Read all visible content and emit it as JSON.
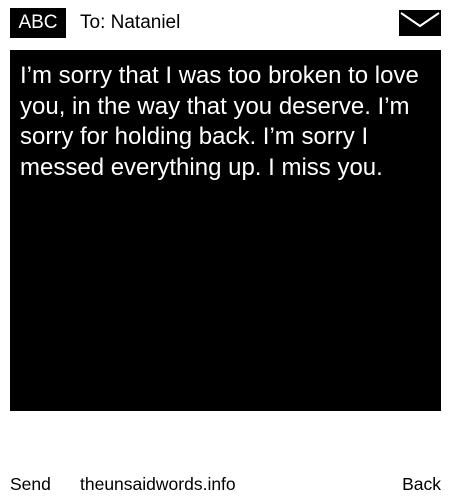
{
  "header": {
    "mode_label": "ABC",
    "recipient": "To: Nataniel",
    "icon": "envelope-icon"
  },
  "message": {
    "text": "I’m sorry that I was too broken to love you, in the way that you deserve. I’m sorry for holding back. I’m sorry I messed everything up. I miss you."
  },
  "footer": {
    "send_label": "Send",
    "site_label": "theunsaidwords.info",
    "back_label": "Back"
  },
  "colors": {
    "background": "#ffffff",
    "message_background": "#000000",
    "message_text": "#ffffff",
    "text": "#000000"
  }
}
